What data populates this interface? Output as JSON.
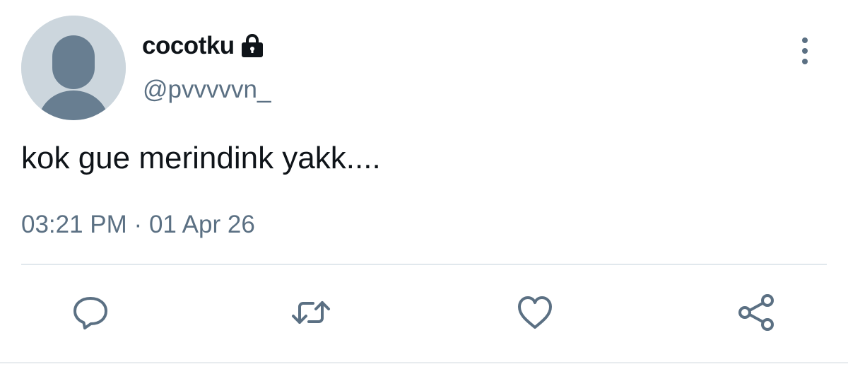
{
  "tweet": {
    "display_name": "cocotku",
    "handle": "@pvvvvvn_",
    "text": "kok gue merindink yakk....",
    "time": "03:21 PM",
    "separator": "·",
    "date": "01 Apr 26",
    "protected": true
  },
  "icons": {
    "avatar": "default-avatar-silhouette",
    "lock": "lock-icon",
    "more": "vertical-ellipsis-icon",
    "reply": "speech-bubble-icon",
    "retweet": "retweet-icon",
    "like": "heart-icon",
    "share": "share-icon"
  },
  "colors": {
    "text_primary": "#0f1419",
    "text_secondary": "#5b7083",
    "icon": "#5b7083",
    "avatar_bg": "#ccd6dd",
    "avatar_fg": "#687e91",
    "divider": "#e1e8ed"
  }
}
